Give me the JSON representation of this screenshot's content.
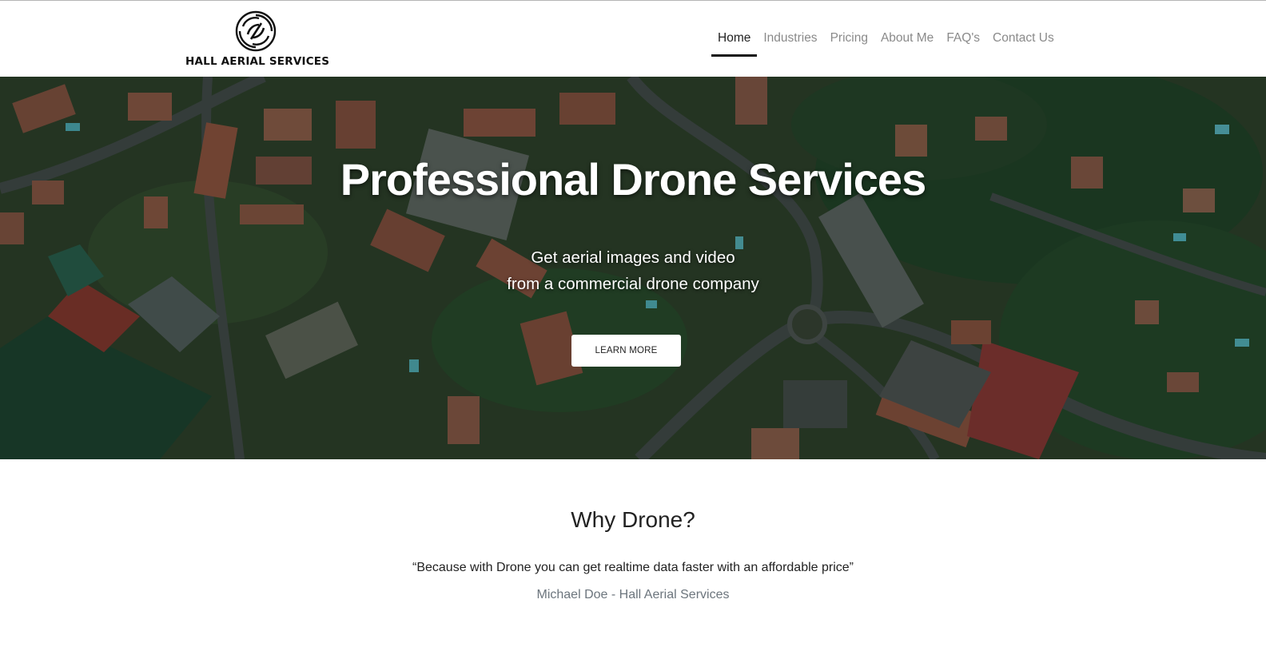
{
  "brand": {
    "name": "HALL AERIAL SERVICES",
    "logo_icon": "spiral-propeller-logo-icon"
  },
  "nav": {
    "items": [
      {
        "label": "Home",
        "active": true
      },
      {
        "label": "Industries",
        "active": false
      },
      {
        "label": "Pricing",
        "active": false
      },
      {
        "label": "About Me",
        "active": false
      },
      {
        "label": "FAQ's",
        "active": false
      },
      {
        "label": "Contact Us",
        "active": false
      }
    ]
  },
  "hero": {
    "title": "Professional Drone Services",
    "subtitle_line1": "Get aerial images and video",
    "subtitle_line2": "from a commercial drone company",
    "button_label": "LEARN MORE",
    "background": "aerial-town-photo"
  },
  "why": {
    "title": "Why Drone?",
    "quote": "“Because with Drone you can get realtime data faster with an affordable price”",
    "author": "Michael Doe - Hall Aerial Services"
  },
  "colors": {
    "accent": "#111111",
    "nav_inactive": "#8a8a8a",
    "author_text": "#6c757d"
  }
}
